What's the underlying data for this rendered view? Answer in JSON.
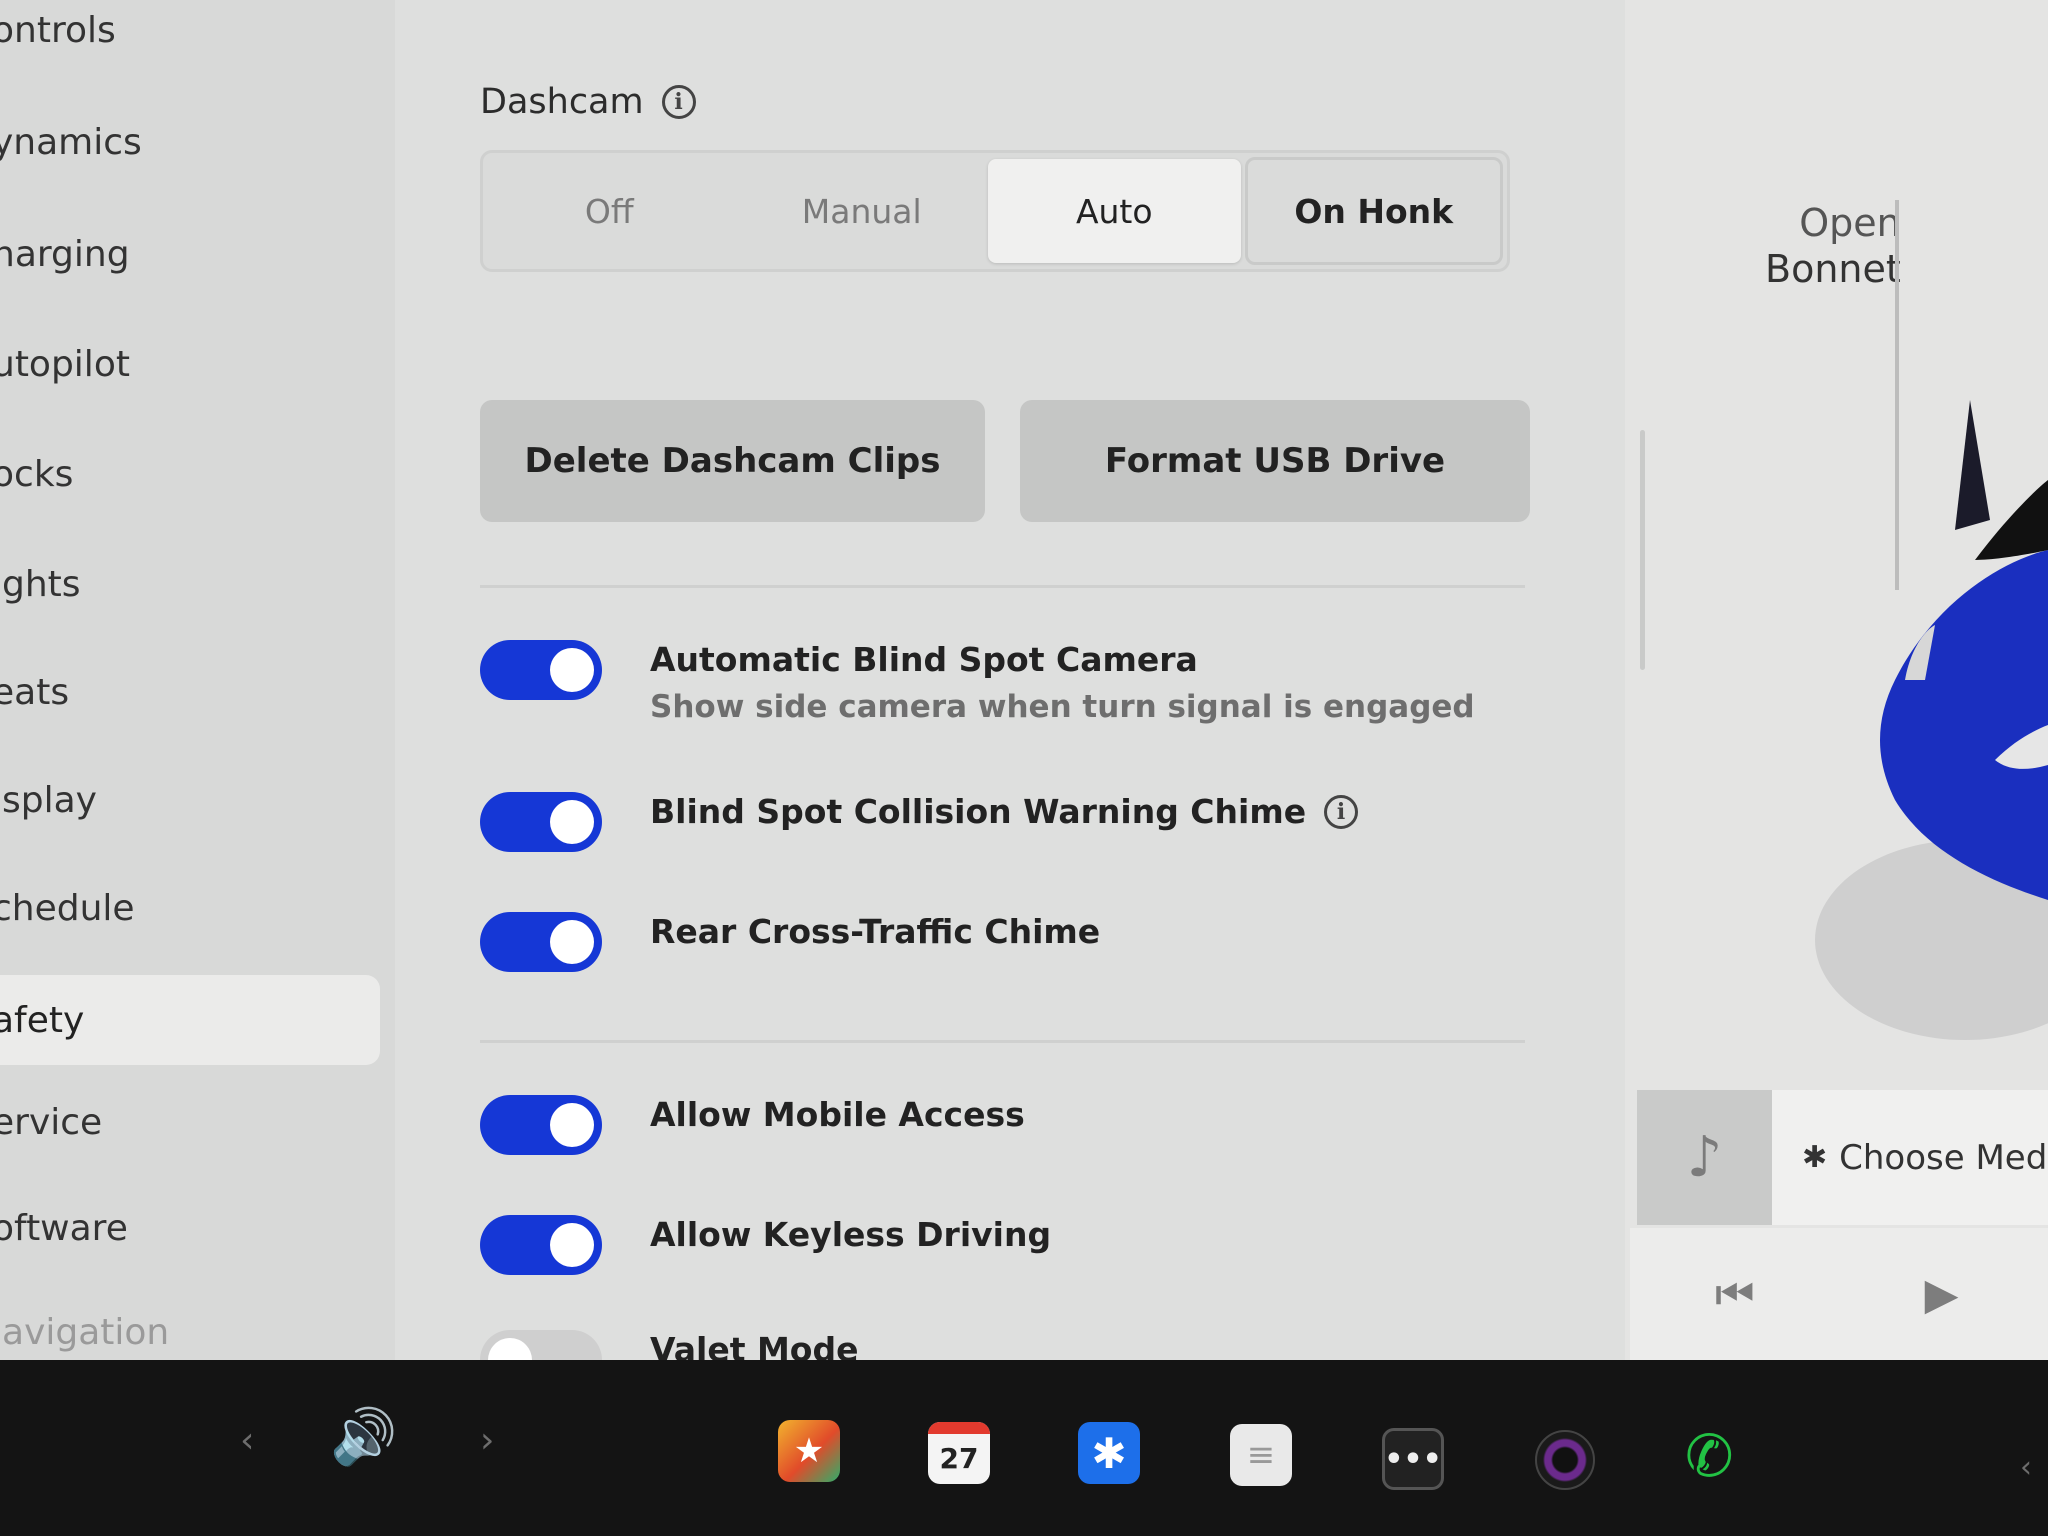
{
  "sidebar": {
    "items": [
      {
        "label": "ontrols"
      },
      {
        "label": "ynamics"
      },
      {
        "label": "harging"
      },
      {
        "label": "utopilot"
      },
      {
        "label": "ocks"
      },
      {
        "label": "ights"
      },
      {
        "label": "eats"
      },
      {
        "label": "isplay"
      },
      {
        "label": "chedule"
      },
      {
        "label": "afety",
        "active": true
      },
      {
        "label": "ervice"
      },
      {
        "label": "oftware"
      },
      {
        "label": "lavigation"
      }
    ]
  },
  "dashcam": {
    "title": "Dashcam",
    "options": [
      "Off",
      "Manual",
      "Auto",
      "On Honk"
    ],
    "selected": "Auto",
    "delete_label": "Delete Dashcam Clips",
    "format_label": "Format USB Drive"
  },
  "toggles": [
    {
      "label": "Automatic Blind Spot Camera",
      "sub": "Show side camera when turn signal is engaged",
      "on": true
    },
    {
      "label": "Blind Spot Collision Warning Chime",
      "on": true,
      "info": true
    },
    {
      "label": "Rear Cross-Traffic Chime",
      "on": true
    },
    {
      "label": "Allow Mobile Access",
      "on": true
    },
    {
      "label": "Allow Keyless Driving",
      "on": true
    },
    {
      "label": "Valet Mode",
      "on": false
    }
  ],
  "car_panel": {
    "hood_line1": "Open",
    "hood_line2": "Bonnet",
    "car_color": "#1a2fbf"
  },
  "media": {
    "choose_label": "Choose Medi",
    "bluetooth_glyph": "✱"
  },
  "taskbar": {
    "calendar_day": "27",
    "accent_blue": "#1537d6",
    "phone_color": "#22c244"
  }
}
